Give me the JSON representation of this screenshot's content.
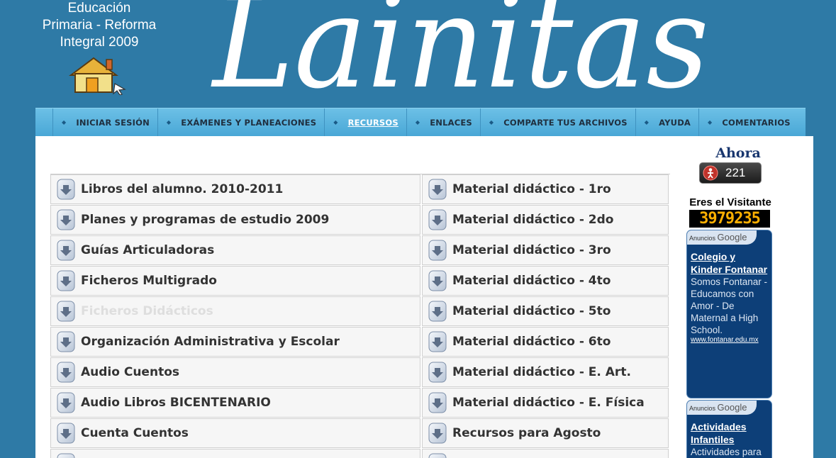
{
  "header": {
    "tagline": [
      "Educación",
      "Primaria - Reforma",
      "Integral 2009"
    ],
    "logo_text": "Lainitas"
  },
  "nav": {
    "items": [
      {
        "label": "INICIAR SESIÓN"
      },
      {
        "label": "EXÁMENES Y PLANEACIONES"
      },
      {
        "label": "RECURSOS",
        "active": true
      },
      {
        "label": "ENLACES"
      },
      {
        "label": "COMPARTE TUS ARCHIVOS"
      },
      {
        "label": "AYUDA"
      },
      {
        "label": "COMENTARIOS"
      }
    ]
  },
  "resources": {
    "left": [
      "Libros del alumno. 2010-2011",
      "Planes y programas de estudio 2009",
      "Guías Articuladoras",
      "Ficheros Multigrado",
      "Ficheros Didácticos",
      "Organización Administrativa y Escolar",
      "Audio Cuentos",
      "Audio Libros BICENTENARIO",
      "Cuenta Cuentos"
    ],
    "right": [
      "Material didáctico - 1ro",
      "Material didáctico - 2do",
      "Material didáctico - 3ro",
      "Material didáctico - 4to",
      "Material didáctico - 5to",
      "Material didáctico - 6to",
      "Material didáctico - E. Art.",
      "Material didáctico - E. Física",
      "Recursos para Agosto"
    ]
  },
  "sidebar": {
    "ahora_label": "Ahora",
    "online_count": "221",
    "visitor_label": "Eres el Visitante",
    "visitor_count": "3979235",
    "ads": [
      {
        "header": "Anuncios",
        "brand": "Google",
        "title": "Colegio y Kinder Fontanar",
        "desc": "Somos Fontanar - Educamos con Amor - De Maternal a High School.",
        "url": "www.fontanar.edu.mx"
      },
      {
        "header": "Anuncios",
        "brand": "Google",
        "title": "Actividades Infantiles",
        "desc": "Actividades para",
        "url": ""
      }
    ]
  },
  "colors": {
    "page_bg": "#2e7aa6",
    "nav_bg": "#49a7d6",
    "ad_bg": "#0d3f78"
  }
}
